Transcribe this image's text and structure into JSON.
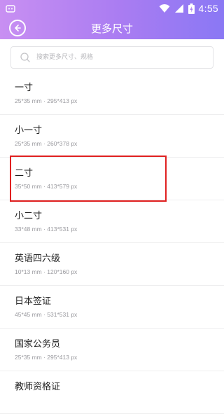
{
  "status_bar": {
    "time": "4:55",
    "icons": [
      "android-icon",
      "wifi-icon",
      "signal-icon",
      "battery-icon"
    ]
  },
  "app_bar": {
    "title": "更多尺寸",
    "back_icon": "back-icon"
  },
  "search": {
    "placeholder": "搜索更多尺寸、规格",
    "value": ""
  },
  "sizes": [
    {
      "name": "一寸",
      "spec": "25*35 mm · 295*413 px"
    },
    {
      "name": "小一寸",
      "spec": "25*35 mm · 260*378 px"
    },
    {
      "name": "二寸",
      "spec": "35*50 mm · 413*579 px",
      "highlighted": true
    },
    {
      "name": "小二寸",
      "spec": "33*48 mm · 413*531 px"
    },
    {
      "name": "英语四六级",
      "spec": "10*13 mm · 120*160 px"
    },
    {
      "name": "日本签证",
      "spec": "45*45 mm · 531*531 px"
    },
    {
      "name": "国家公务员",
      "spec": "25*35 mm · 295*413 px"
    },
    {
      "name": "教师资格证",
      "spec": ""
    }
  ],
  "colors": {
    "header_start": "#c88ff2",
    "header_end": "#8a78f4",
    "highlight": "#e02020"
  }
}
